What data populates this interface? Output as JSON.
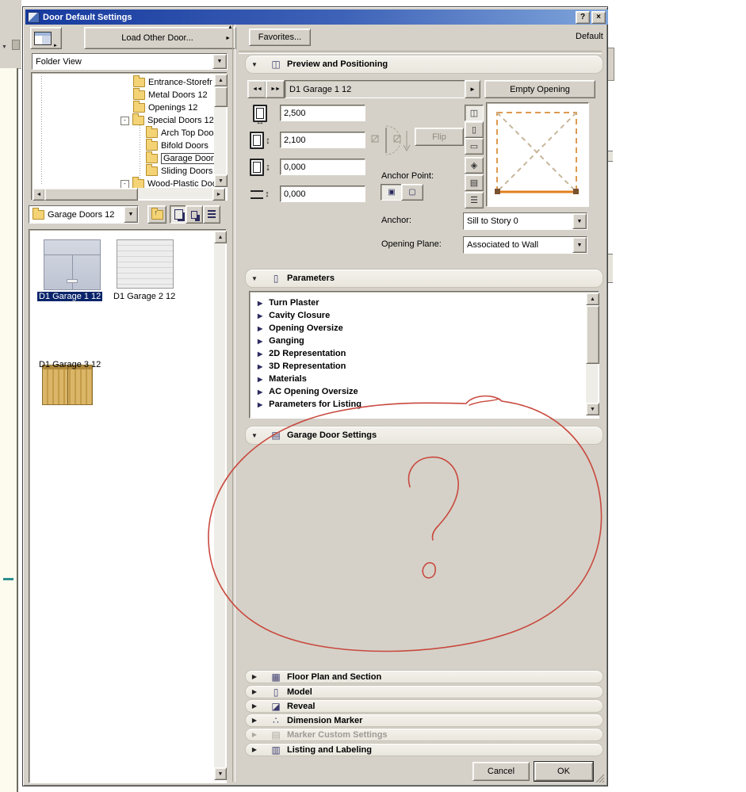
{
  "window": {
    "title": "Door Default Settings",
    "help": "?",
    "close": "×"
  },
  "left": {
    "load_button": "Load Other Door...",
    "view_combo": "Folder View",
    "tree": {
      "items": [
        {
          "label": "Entrance-Storefr"
        },
        {
          "label": "Metal Doors 12"
        },
        {
          "label": "Openings 12"
        },
        {
          "label": "Special Doors 12",
          "expander": "minus"
        },
        {
          "label": "Arch Top Doo",
          "child": true
        },
        {
          "label": "Bifold Doors",
          "child": true
        },
        {
          "label": "Garage Door",
          "child": true,
          "selected": true
        },
        {
          "label": "Sliding Doors",
          "child": true
        },
        {
          "label": "Wood-Plastic Doo",
          "expander": "minus"
        }
      ]
    },
    "folder_combo": "Garage Doors 12",
    "thumbs": [
      {
        "label": "D1 Garage 1 12",
        "selected": true
      },
      {
        "label": "D1 Garage 2 12",
        "selected": false
      },
      {
        "label": "D1 Garage 3 12",
        "selected": false
      }
    ]
  },
  "right": {
    "favorites": "Favorites...",
    "default_label": "Default",
    "preview": {
      "title": "Preview and Positioning",
      "name": "D1 Garage 1 12",
      "empty_button": "Empty Opening",
      "dims": [
        "2,500",
        "2,100",
        "0,000",
        "0,000"
      ],
      "flip_button": "Flip",
      "anchor_point_label": "Anchor Point:",
      "anchor_label": "Anchor:",
      "anchor_value": "Sill to Story 0",
      "plane_label": "Opening Plane:",
      "plane_value": "Associated to Wall"
    },
    "parameters": {
      "title": "Parameters",
      "items": [
        "Turn Plaster",
        "Cavity Closure",
        "Opening Oversize",
        "Ganging",
        "2D Representation",
        "3D Representation",
        "Materials",
        "AC Opening Oversize",
        "Parameters for Listing"
      ]
    },
    "garage_settings_title": "Garage Door Settings",
    "sections": [
      {
        "label": "Floor Plan and Section",
        "disabled": false
      },
      {
        "label": "Model",
        "disabled": false
      },
      {
        "label": "Reveal",
        "disabled": false
      },
      {
        "label": "Dimension Marker",
        "disabled": false
      },
      {
        "label": "Marker Custom Settings",
        "disabled": true
      },
      {
        "label": "Listing and Labeling",
        "disabled": false
      }
    ],
    "cancel": "Cancel",
    "ok": "OK"
  },
  "icons": {
    "collapse": "▼",
    "expand": "▶",
    "dropdown": "▼",
    "scroll_up": "▲",
    "scroll_down": "▼",
    "scroll_left": "◄",
    "scroll_right": "►",
    "prev": "◄◄",
    "next": "►►",
    "more": "►",
    "minus": "-",
    "panel_collapse": "▲",
    "up_arrow": "↑",
    "dim_arrows": [
      "↔",
      "↕",
      "↨",
      "↕"
    ],
    "anchor_a": "▣",
    "anchor_b": "▢",
    "preview_tools": [
      "◫",
      "▯",
      "▭",
      "◈",
      "▤",
      "☰"
    ],
    "section_icons": {
      "preview": "◫",
      "parameters": "▯",
      "garage": "▤",
      "floor": "▦",
      "model": "▯",
      "reveal": "◪",
      "dimension": "∴",
      "marker": "▤",
      "listing": "▥"
    }
  },
  "colors": {
    "titlebar_start": "#16399E",
    "titlebar_end": "#7FA5DB",
    "selection_navy": "#0A246A",
    "accent_orange": "#E2801E",
    "annotation_red": "#C9493F",
    "dialog_bg": "#D5D1C8",
    "teal_mark": "#2F8F8F"
  }
}
